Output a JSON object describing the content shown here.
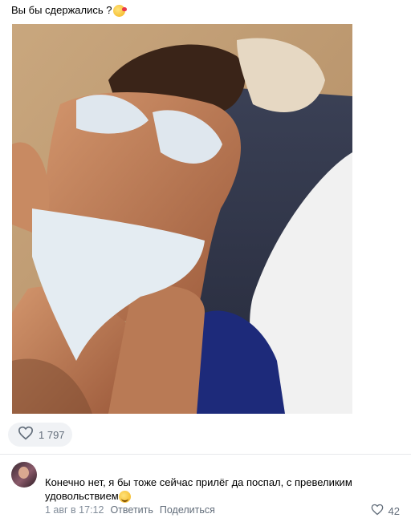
{
  "post": {
    "text": "Вы бы сдержались ?",
    "emoji_icon": "kissing-face-icon",
    "photo_alt": "photo"
  },
  "likes": {
    "icon": "heart-icon",
    "count": "1 797"
  },
  "comment": {
    "text": "Конечно нет, я бы тоже сейчас прилёг да поспал, с превеликим удовольствием",
    "emoji_icon": "smiling-face-icon",
    "date": "1 авг в 17:12",
    "reply_label": "Ответить",
    "share_label": "Поделиться",
    "like_count": "42"
  },
  "colors": {
    "secondary_text": "#818c99",
    "action_text": "#626d7a",
    "pill_bg": "#f0f2f5"
  }
}
